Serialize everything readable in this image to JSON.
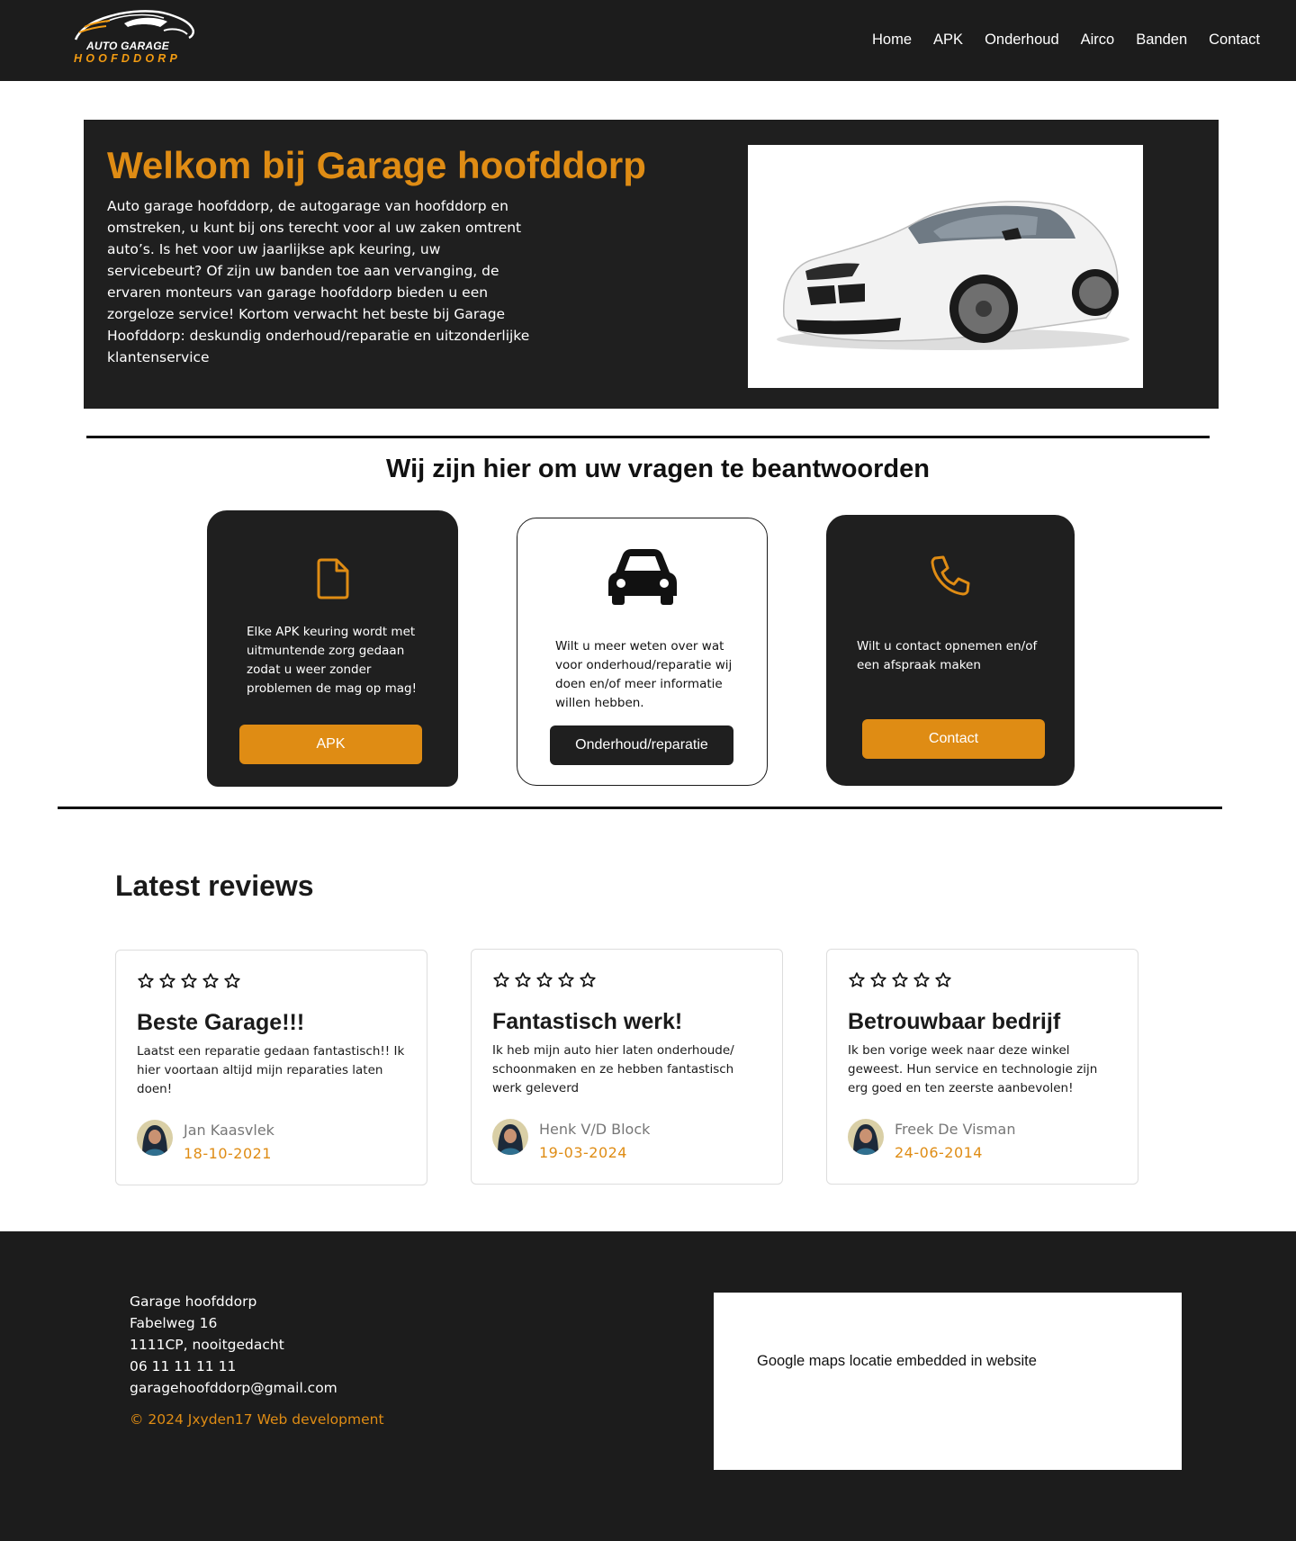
{
  "nav": {
    "logo_top": "AUTO GARAGE",
    "logo_bottom": "HOOFDDORP",
    "links": [
      "Home",
      "APK",
      "Onderhoud",
      "Airco",
      "Banden",
      "Contact"
    ]
  },
  "hero": {
    "title": "Welkom bij Garage hoofddorp",
    "text": "Auto garage hoofddorp, de autogarage van hoofddorp en omstreken, u kunt bij ons terecht voor  al uw zaken omtrent auto’s. Is het voor uw jaarlijkse apk keuring, uw  servicebeurt? Of zijn uw banden toe aan vervanging, de ervaren monteurs van garage hoofddorp bieden u een zorgeloze service! Kortom verwacht het beste bij Garage Hoofddorp: deskundig onderhoud/reparatie en uitzonderlijke klantenservice"
  },
  "services": {
    "title": "Wij zijn hier om uw vragen te beantwoorden",
    "cards": [
      {
        "icon": "document-icon",
        "text": "Elke APK keuring wordt met uitmuntende zorg gedaan zodat u weer zonder problemen de mag op mag!",
        "button": "APK"
      },
      {
        "icon": "car-icon",
        "text": "Wilt u meer weten over wat voor onderhoud/reparatie wij doen en/of meer informatie willen hebben.",
        "button": "Onderhoud/reparatie"
      },
      {
        "icon": "phone-icon",
        "text": "Wilt u contact opnemen en/of een afspraak maken",
        "button": "Contact"
      }
    ]
  },
  "reviews": {
    "title": "Latest reviews",
    "items": [
      {
        "title": "Beste Garage!!!",
        "text": "Laatst een reparatie gedaan fantastisch!! Ik hier voortaan altijd mijn reparaties laten doen!",
        "name": "Jan Kaasvlek",
        "date": "18-10-2021",
        "stars": 0
      },
      {
        "title": "Fantastisch werk!",
        "text": "Ik heb mijn auto hier laten onderhoude/ schoonmaken en ze hebben fantastisch werk geleverd",
        "name": "Henk V/D Block",
        "date": "19-03-2024",
        "stars": 0
      },
      {
        "title": "Betrouwbaar bedrijf",
        "text": "Ik ben vorige week naar deze winkel geweest. Hun service en technologie zijn erg goed en ten zeerste aanbevolen!",
        "name": "Freek De Visman",
        "date": "24-06-2014",
        "stars": 0
      }
    ]
  },
  "footer": {
    "address_lines": [
      "Garage hoofddorp",
      "Fabelweg 16",
      "1111CP, nooitgedacht",
      "06 11 11 11 11",
      "garagehoofddorp@gmail.com"
    ],
    "copyright": "© 2024 Jxyden17 Web development",
    "map_text": "Google maps locatie embedded in website"
  },
  "colors": {
    "accent": "#df8c14",
    "dark": "#1f1f1f",
    "nav_bg": "#1c1c1c"
  }
}
